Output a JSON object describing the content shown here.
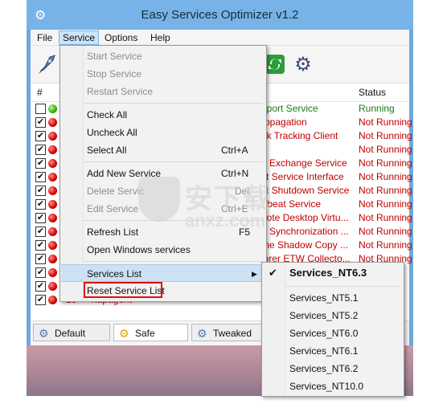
{
  "window": {
    "title": "Easy Services Optimizer v1.2"
  },
  "menubar": {
    "file": "File",
    "service": "Service",
    "options": "Options",
    "help": "Help"
  },
  "toolbar": {
    "icons": [
      "rocket-icon",
      "refresh-icon",
      "gears-icon"
    ]
  },
  "list": {
    "col_number": "#",
    "col_status": "Status",
    "rows": [
      {
        "checked": false,
        "dot": "green",
        "name": "pport Service",
        "status": "Running"
      },
      {
        "checked": true,
        "dot": "red",
        "name": "ropagation",
        "status": "Not Running"
      },
      {
        "checked": true,
        "dot": "red",
        "name": "nk Tracking Client",
        "status": "Not Running"
      },
      {
        "checked": true,
        "dot": "red",
        "name": "y",
        "status": "Not Running"
      },
      {
        "checked": true,
        "dot": "red",
        "name": "a Exchange Service",
        "status": "Not Running"
      },
      {
        "checked": true,
        "dot": "red",
        "name": "st Service Interface",
        "status": "Not Running"
      },
      {
        "checked": true,
        "dot": "red",
        "name": "st Shutdown Service",
        "status": "Not Running"
      },
      {
        "checked": true,
        "dot": "red",
        "name": "rtbeat Service",
        "status": "Not Running"
      },
      {
        "checked": true,
        "dot": "red",
        "name": "note Desktop Virtu...",
        "status": "Not Running"
      },
      {
        "checked": true,
        "dot": "red",
        "name": "e Synchronization ...",
        "status": "Not Running"
      },
      {
        "checked": true,
        "dot": "red",
        "name": "me Shadow Copy ...",
        "status": "Not Running"
      },
      {
        "checked": true,
        "dot": "red",
        "name": "lorer ETW Collecto...",
        "status": "Not Running"
      },
      {
        "checked": true,
        "dot": "red",
        "name": "",
        "status": ""
      },
      {
        "checked": true,
        "dot": "red",
        "name": "",
        "status": ""
      },
      {
        "checked": true,
        "dot": "red",
        "number": "16",
        "service": "napagent",
        "name": "Network Ac",
        "status": ""
      }
    ]
  },
  "tabs": {
    "default": "Default",
    "safe": "Safe",
    "tweaked": "Tweaked"
  },
  "service_menu": {
    "start": "Start Service",
    "stop": "Stop Service",
    "restart": "Restart Service",
    "check_all": "Check All",
    "uncheck_all": "Uncheck All",
    "select_all": "Select All",
    "select_all_sc": "Ctrl+A",
    "add_new": "Add New Service",
    "add_new_sc": "Ctrl+N",
    "delete": "Delete Servic",
    "delete_sc": "Del",
    "edit": "Edit Service",
    "edit_sc": "Ctrl+E",
    "refresh": "Refresh List",
    "refresh_sc": "F5",
    "open_windows": "Open Windows services",
    "services_list": "Services List",
    "reset": "Reset Service List"
  },
  "services_submenu": {
    "checked": "Services_NT6.3",
    "items": [
      "Services_NT5.1",
      "Services_NT5.2",
      "Services_NT6.0",
      "Services_NT6.1",
      "Services_NT6.2",
      "Services_NT10.0"
    ]
  },
  "watermark": {
    "text": "安下载",
    "sub": "anxz.com"
  }
}
